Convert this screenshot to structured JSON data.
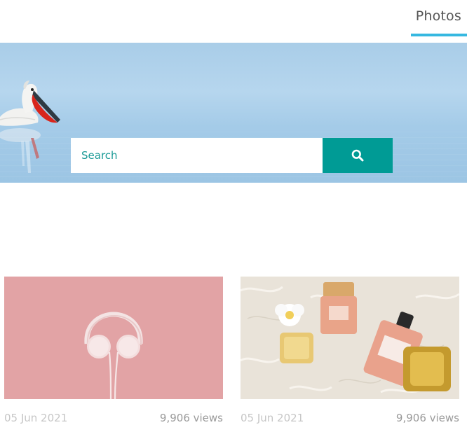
{
  "nav": {
    "tabs": [
      {
        "label": "Photos",
        "active": true
      }
    ],
    "accent_color": "#36b8e0"
  },
  "search": {
    "placeholder": "Search",
    "button_icon": "search-icon",
    "button_color": "#009b95"
  },
  "photos": [
    {
      "subject": "headphones",
      "date": "05 Jun 2021",
      "views": "9,906 views"
    },
    {
      "subject": "perfume",
      "date": "05 Jun 2021",
      "views": "9,906 views"
    }
  ]
}
